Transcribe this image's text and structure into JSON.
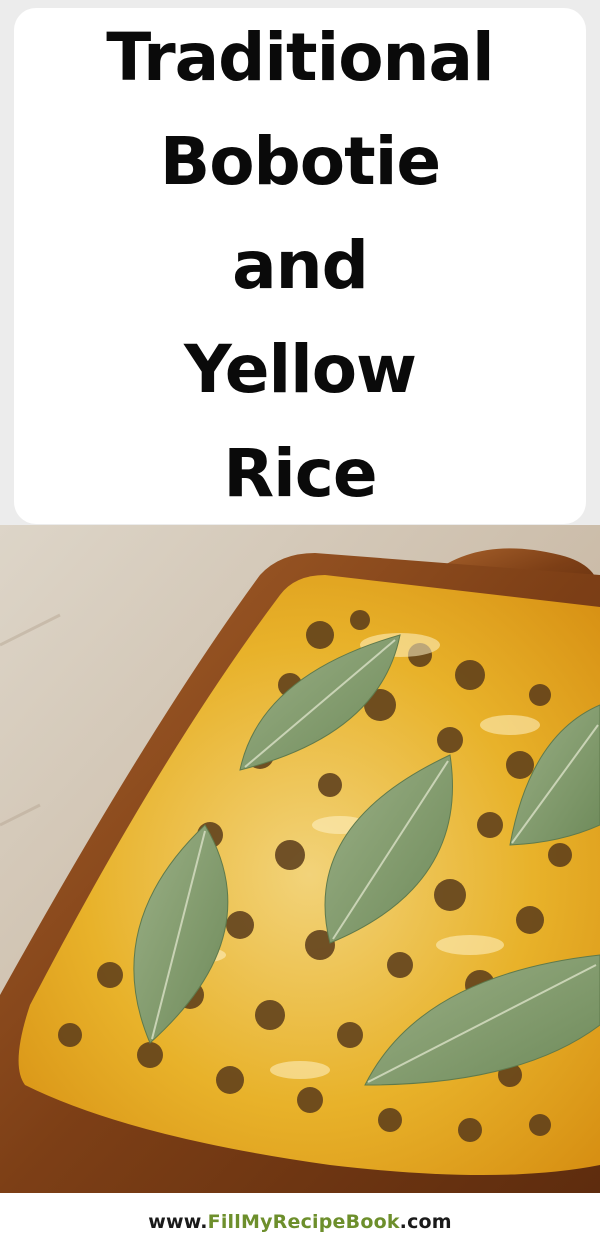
{
  "title": {
    "lines": [
      "Traditional",
      "Bobotie",
      "and",
      "Yellow",
      "Rice"
    ]
  },
  "photo": {
    "subject": "bobotie-dish-with-bay-leaves"
  },
  "footer": {
    "url_prefix": "www.",
    "url_brand": "FillMyRecipeBook",
    "url_suffix": ".com"
  },
  "colors": {
    "title_text": "#0a0a0a",
    "card_bg": "#ffffff",
    "dish_rim": "#8a4a1c",
    "custard": "#e6a81e",
    "bay_leaf": "#7f9a6a",
    "brand_accent": "#6d8f2c"
  }
}
